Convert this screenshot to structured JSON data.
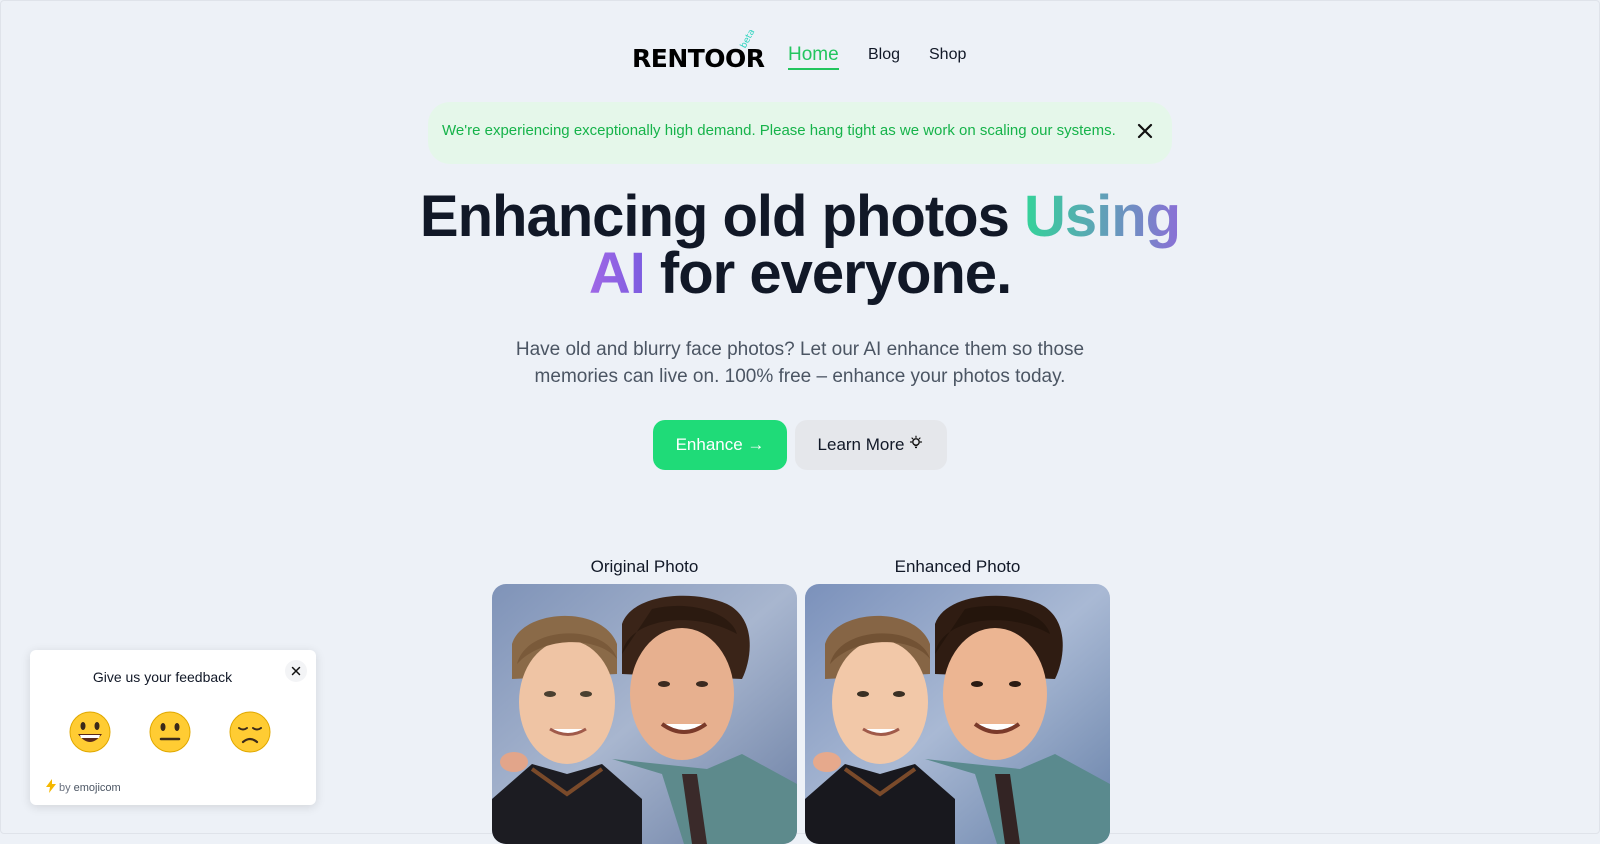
{
  "nav": {
    "logo": "RENTOOR",
    "logo_badge": "beta",
    "links": [
      {
        "label": "Home",
        "active": true
      },
      {
        "label": "Blog",
        "active": false
      },
      {
        "label": "Shop",
        "active": false
      }
    ]
  },
  "banner": {
    "text": "We're experiencing exceptionally high demand. Please hang tight as we work on scaling our systems.",
    "close_icon": "close-icon"
  },
  "hero": {
    "title_part1": "Enhancing old photos ",
    "title_highlight1": "Using",
    "title_highlight2": "AI",
    "title_part2": " for everyone.",
    "subtitle": "Have old and blurry face photos? Let our AI enhance them so those memories can live on. 100% free – enhance your photos today.",
    "enhance_button": "Enhance →",
    "learn_more_button": "Learn More",
    "learn_more_icon": "lightbulb-icon"
  },
  "comparison": {
    "original_label": "Original Photo",
    "enhanced_label": "Enhanced Photo"
  },
  "feedback": {
    "title": "Give us your feedback",
    "options": [
      "happy-face-icon",
      "neutral-face-icon",
      "sad-face-icon"
    ],
    "by_text": "by",
    "brand": "emojicom"
  },
  "colors": {
    "accent_green": "#22c55e",
    "button_green": "#1fdb78",
    "banner_bg": "#e5f7ea",
    "gradient_purple": "#8b6fd6",
    "background": "#edf1f7"
  }
}
